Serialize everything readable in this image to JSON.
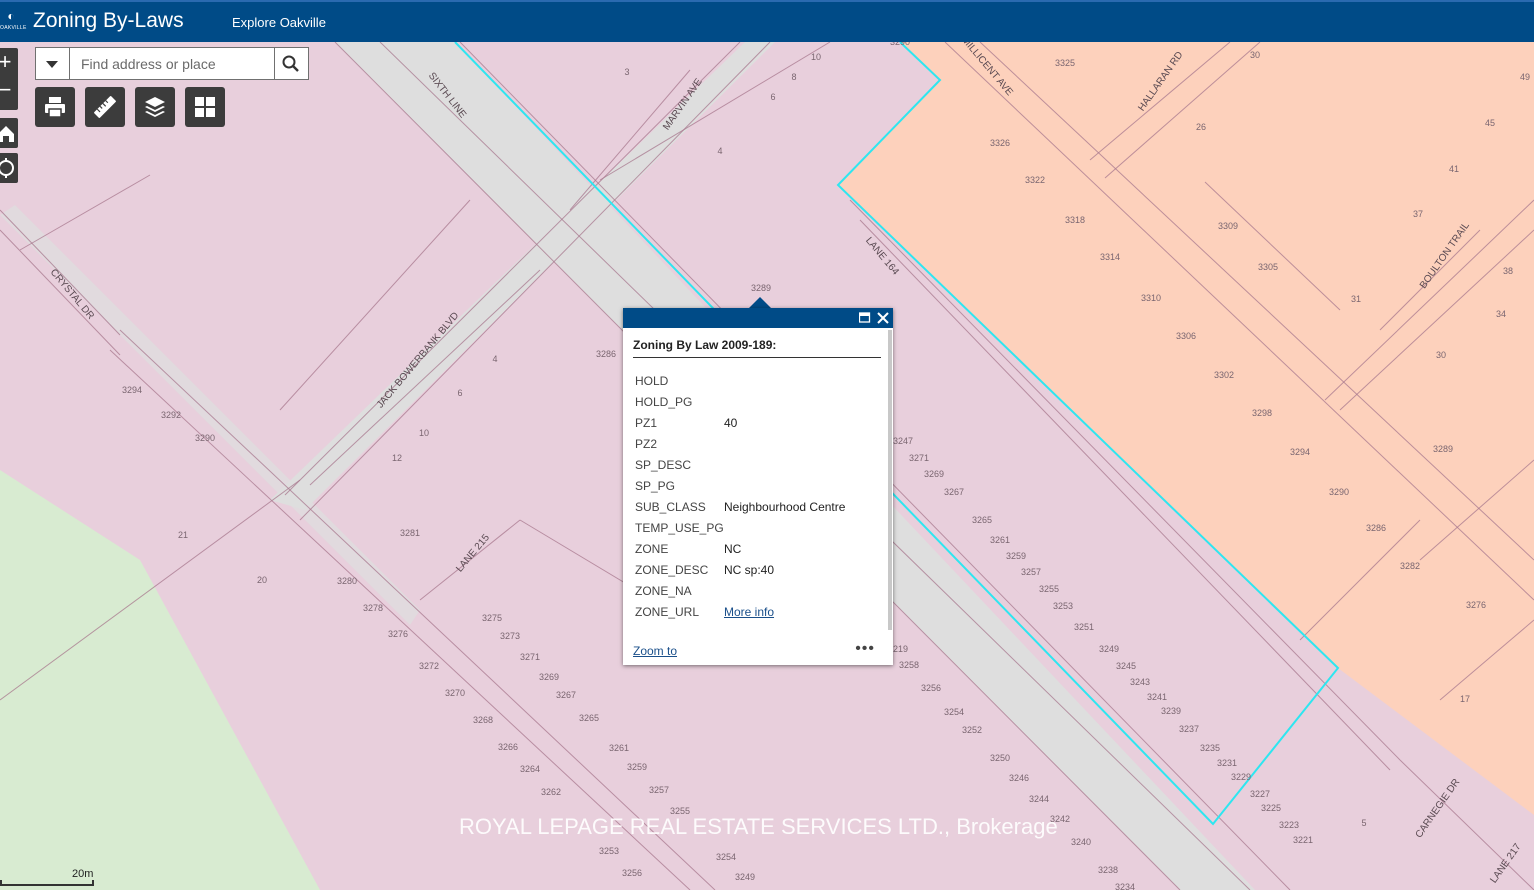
{
  "header": {
    "logo_text": "OAKVILLE",
    "title": "Zoning By-Laws",
    "explore_link": "Explore Oakville"
  },
  "colors": {
    "header": "#004b87",
    "residential_zone": "#e8cfdc",
    "commercial_zone": "#fdd1bc",
    "park_zone": "#d8ebd1",
    "road": "#dedede",
    "selection_outline": "#2ee6f0"
  },
  "map_controls": {
    "zoom_in": "+",
    "zoom_out": "−",
    "home_icon": "home-icon",
    "locate_icon": "locate-icon"
  },
  "search": {
    "placeholder": "Find address or place"
  },
  "toolbar": {
    "tools": [
      "print-icon",
      "measure-icon",
      "layers-icon",
      "basemap-gallery-icon"
    ]
  },
  "streets": [
    "SIXTH LINE",
    "MARVIN AVE",
    "MILLICENT AVE",
    "HALLARAN RD",
    "LANE 164",
    "BOULTON TRAIL",
    "CRYSTAL DR",
    "JACK BOWERBANK BLVD",
    "LANE 215",
    "CARNEGIE DR",
    "LANE 217"
  ],
  "parcel_numbers": [
    "3290",
    "3325",
    "30",
    "49",
    "3",
    "8",
    "10",
    "6",
    "4",
    "3326",
    "3322",
    "26",
    "45",
    "41",
    "37",
    "3318",
    "3309",
    "3314",
    "3305",
    "3310",
    "31",
    "38",
    "34",
    "3306",
    "3302",
    "30",
    "3298",
    "3294",
    "3289",
    "3290",
    "3286",
    "3282",
    "3276",
    "17",
    "5",
    "3289",
    "3286",
    "3294",
    "3292",
    "3290",
    "4",
    "6",
    "10",
    "12",
    "21",
    "20",
    "3281",
    "3280",
    "3278",
    "3276",
    "3272",
    "3270",
    "3268",
    "3266",
    "3264",
    "3262",
    "3275",
    "3273",
    "3271",
    "3269",
    "3267",
    "3265",
    "3261",
    "3259",
    "3257",
    "3255",
    "3253",
    "3256",
    "3254",
    "3249",
    "3247",
    "3271",
    "3269",
    "3267",
    "3265",
    "3261",
    "3259",
    "3257",
    "3255",
    "3253",
    "3251",
    "3249",
    "3245",
    "3243",
    "3241",
    "3239",
    "3237",
    "3235",
    "3231",
    "3229",
    "3227",
    "3225",
    "3223",
    "3221",
    "3219",
    "3258",
    "3256",
    "3254",
    "3252",
    "3250",
    "3246",
    "3244",
    "3242",
    "3240",
    "3238",
    "3234",
    "3232"
  ],
  "popup": {
    "title": "Zoning By Law 2009-189:",
    "fields": [
      {
        "key": "HOLD",
        "value": ""
      },
      {
        "key": "HOLD_PG",
        "value": ""
      },
      {
        "key": "PZ1",
        "value": "40"
      },
      {
        "key": "PZ2",
        "value": ""
      },
      {
        "key": "SP_DESC",
        "value": ""
      },
      {
        "key": "SP_PG",
        "value": ""
      },
      {
        "key": "SUB_CLASS",
        "value": "Neighbourhood Centre"
      },
      {
        "key": "TEMP_USE_PG",
        "value": ""
      },
      {
        "key": "ZONE",
        "value": "NC"
      },
      {
        "key": "ZONE_DESC",
        "value": "NC sp:40"
      },
      {
        "key": "ZONE_NA",
        "value": ""
      },
      {
        "key": "ZONE_URL",
        "value": "More info"
      }
    ],
    "zoom_to": "Zoom to",
    "more": "•••"
  },
  "watermark": "ROYAL LEPAGE REAL ESTATE SERVICES LTD., Brokerage",
  "scale": "20m"
}
